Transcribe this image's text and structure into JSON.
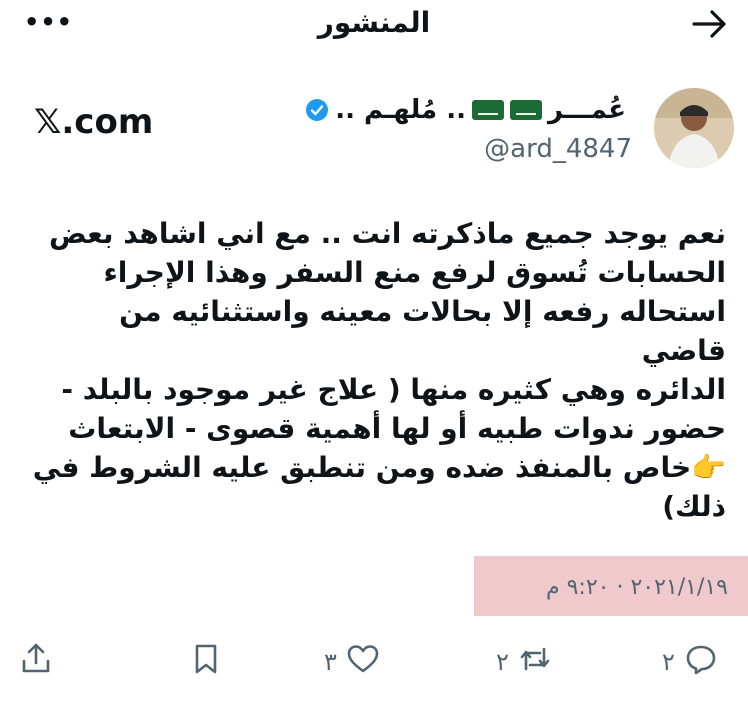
{
  "header": {
    "title": "المنشور",
    "more_label": "•••"
  },
  "author": {
    "name_part1": "عُمـــر",
    "name_part2": ".. مُلهـم ..",
    "handle": "@ard_4847"
  },
  "brand": {
    "text": "𝕏.com"
  },
  "tweet": {
    "lines": [
      "نعم يوجد جميع ماذكرته انت .. مع اني اشاهد بعض",
      "الحسابات تُسوق لرفع منع السفر وهذا الإجراء",
      "استحاله رفعه إلا بحالات معينه واستثنائيه من قاضي",
      "الدائره وهي كثيره منها ( علاج غير موجود بالبلد -",
      "حضور ندوات طبيه أو لها أهمية قصوى - الابتعاث",
      "👉خاص بالمنفذ ضده ومن تنطبق عليه الشروط في",
      "ذلك)"
    ]
  },
  "meta": {
    "date": "٢٠٢١/١/١٩ · ٩:٢٠ م"
  },
  "actions": {
    "replies": "٢",
    "retweets": "٢",
    "likes": "٣"
  },
  "colors": {
    "highlight": "#efc9cc",
    "verified": "#1d9bf0",
    "muted": "#536471"
  }
}
